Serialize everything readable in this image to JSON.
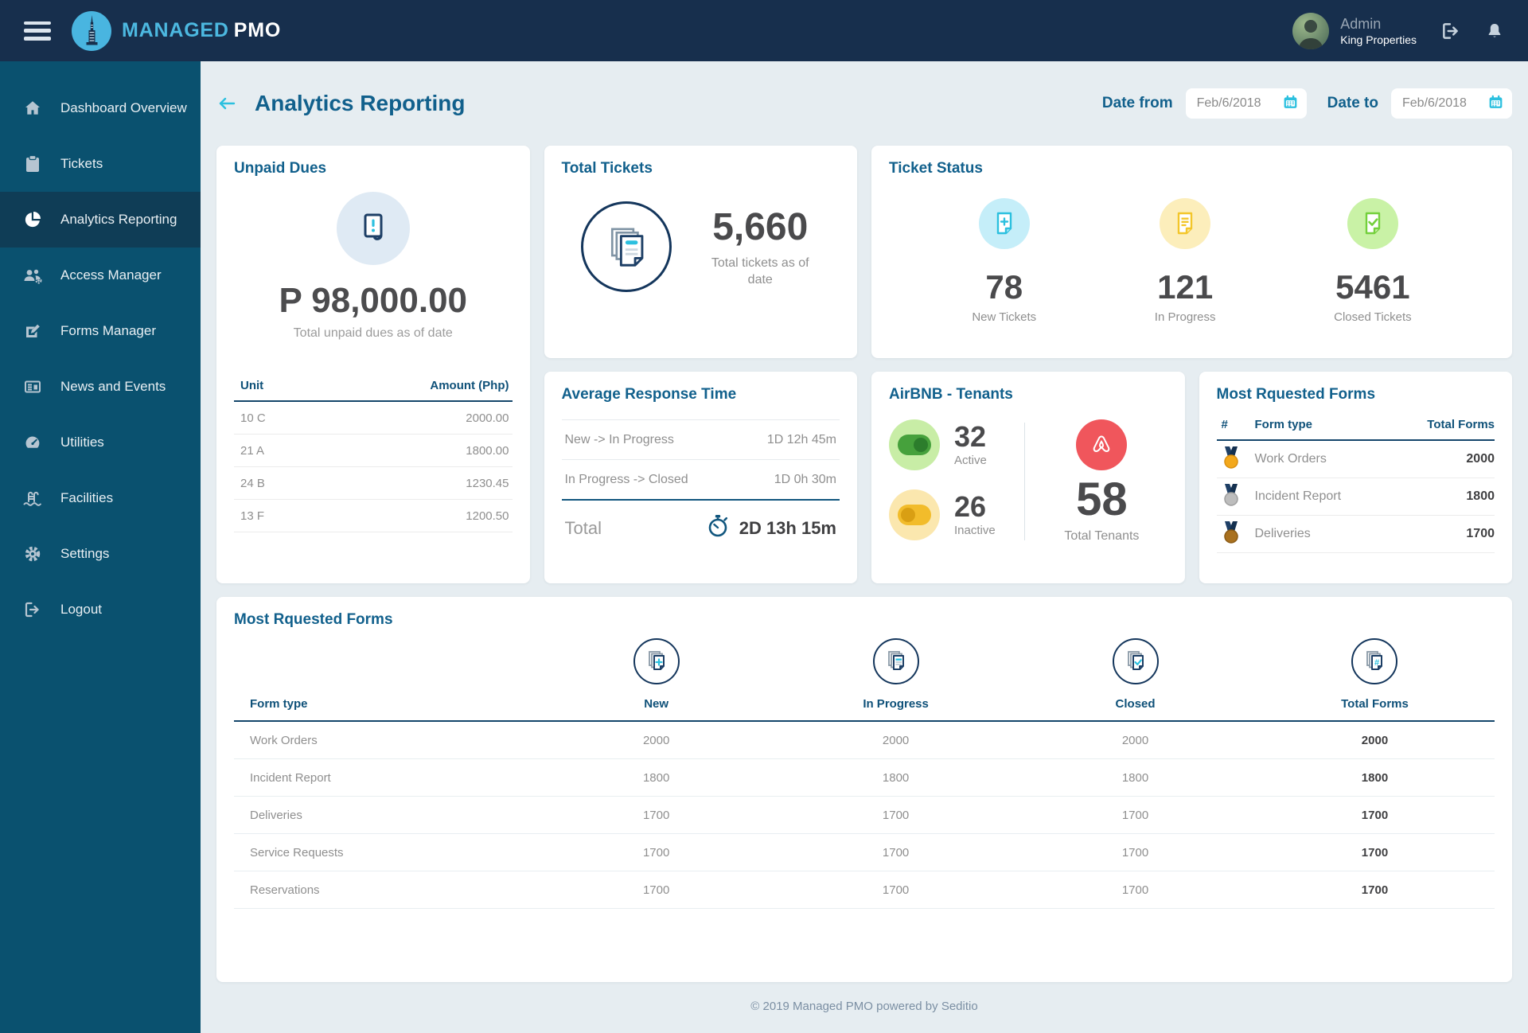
{
  "colors": {
    "navbar_bg": "#172f4d",
    "sidebar_bg": "#0a516f",
    "sidebar_active_bg": "#0f3d56",
    "content_bg": "#e6edf1",
    "accent_cyan": "#2cc0df",
    "title_navy": "#11608c",
    "status_new": "#2cc0df",
    "status_in_progress": "#f3c62a",
    "status_closed": "#74d03c",
    "airbnb_red": "#f0565c"
  },
  "navbar": {
    "brand_managed": "MANAGED",
    "brand_pmo": "PMO",
    "user_name": "Admin",
    "user_company": "King Properties",
    "icons": [
      "hamburger-icon",
      "logout-icon",
      "bell-icon"
    ]
  },
  "sidebar": {
    "items": [
      {
        "label": "Dashboard Overview",
        "icon": "home-icon",
        "active": false
      },
      {
        "label": "Tickets",
        "icon": "clipboard-icon",
        "active": false
      },
      {
        "label": "Analytics Reporting",
        "icon": "pie-chart-icon",
        "active": true
      },
      {
        "label": "Access Manager",
        "icon": "users-gear-icon",
        "active": false
      },
      {
        "label": "Forms Manager",
        "icon": "edit-icon",
        "active": false
      },
      {
        "label": "News and Events",
        "icon": "newspaper-icon",
        "active": false
      },
      {
        "label": "Utilities",
        "icon": "gauge-icon",
        "active": false
      },
      {
        "label": "Facilities",
        "icon": "pool-ladder-icon",
        "active": false
      },
      {
        "label": "Settings",
        "icon": "gear-icon",
        "active": false
      },
      {
        "label": "Logout",
        "icon": "logout-icon",
        "active": false
      }
    ]
  },
  "header": {
    "title": "Analytics Reporting",
    "back_icon": "back-arrow-icon",
    "date_from_label": "Date from",
    "date_from_value": "Feb/6/2018",
    "date_to_label": "Date to",
    "date_to_value": "Feb/6/2018",
    "calendar_icon": "calendar-icon"
  },
  "cards": {
    "unpaid_dues": {
      "title": "Unpaid Dues",
      "icon": "receipt-alert-icon",
      "total": "P 98,000.00",
      "subtitle": "Total unpaid dues as of date",
      "columns": {
        "unit": "Unit",
        "amount": "Amount  (Php)"
      },
      "rows": [
        [
          "10 C",
          "2000.00"
        ],
        [
          "21 A",
          "1800.00"
        ],
        [
          "24 B",
          "1230.45"
        ],
        [
          "13 F",
          "1200.50"
        ]
      ]
    },
    "total_tickets": {
      "title": "Total Tickets",
      "icon": "documents-stack-icon",
      "value": "5,660",
      "subtitle": "Total tickets as of date"
    },
    "ticket_status": {
      "title": "Ticket Status",
      "items": [
        {
          "value": "78",
          "label": "New Tickets",
          "icon": "document-plus-icon"
        },
        {
          "value": "121",
          "label": "In Progress",
          "icon": "document-lines-icon"
        },
        {
          "value": "5461",
          "label": "Closed Tickets",
          "icon": "document-check-icon"
        }
      ]
    },
    "avg_response": {
      "title": "Average Response Time",
      "rows": [
        {
          "label": "New -> In Progress",
          "value": "1D 12h 45m"
        },
        {
          "label": "In Progress -> Closed",
          "value": "1D 0h 30m"
        }
      ],
      "total_label": "Total",
      "total_icon": "stopwatch-icon",
      "total_value": "2D 13h 15m"
    },
    "airbnb": {
      "title": "AirBNB - Tenants",
      "active_value": "32",
      "active_label": "Active",
      "active_icon": "toggle-on-icon",
      "inactive_value": "26",
      "inactive_label": "Inactive",
      "inactive_icon": "toggle-off-icon",
      "logo_icon": "airbnb-icon",
      "total_value": "58",
      "total_label": "Total Tenants"
    },
    "most_requested_side": {
      "title": "Most Rquested Forms",
      "columns": {
        "rank": "#",
        "form": "Form type",
        "total": "Total Forms"
      },
      "rows": [
        {
          "medal": "gold-medal-icon",
          "form": "Work Orders",
          "total": "2000"
        },
        {
          "medal": "silver-medal-icon",
          "form": "Incident Report",
          "total": "1800"
        },
        {
          "medal": "bronze-medal-icon",
          "form": "Deliveries",
          "total": "1700"
        }
      ]
    },
    "most_requested_table": {
      "title": "Most Rquested Forms",
      "column_icons": [
        "documents-plus-icon",
        "documents-lines-icon",
        "documents-check-icon",
        "documents-count-icon"
      ],
      "columns": [
        "Form type",
        "New",
        "In Progress",
        "Closed",
        "Total Forms"
      ],
      "rows": [
        [
          "Work Orders",
          "2000",
          "2000",
          "2000",
          "2000"
        ],
        [
          "Incident Report",
          "1800",
          "1800",
          "1800",
          "1800"
        ],
        [
          "Deliveries",
          "1700",
          "1700",
          "1700",
          "1700"
        ],
        [
          "Service Requests",
          "1700",
          "1700",
          "1700",
          "1700"
        ],
        [
          "Reservations",
          "1700",
          "1700",
          "1700",
          "1700"
        ]
      ]
    }
  },
  "footer": {
    "copyright": "© 2019 Managed PMO powered by Seditio"
  }
}
